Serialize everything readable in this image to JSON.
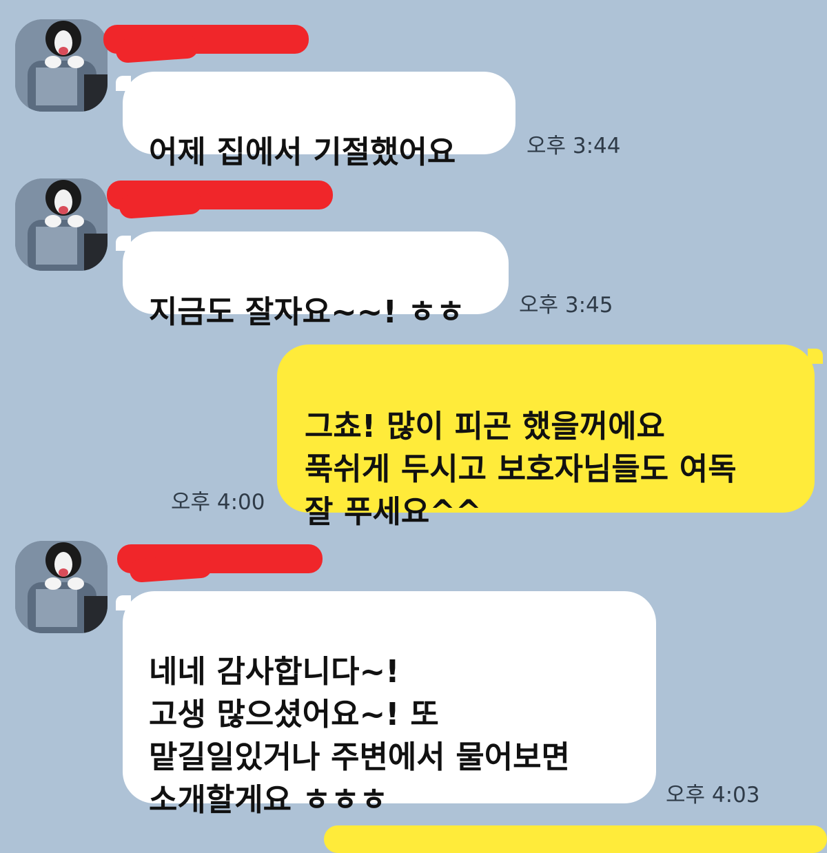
{
  "messages": [
    {
      "sender": "other",
      "text": "어제 집에서 기절했어요",
      "time": "오후 3:44"
    },
    {
      "sender": "other",
      "text": "지금도 잘자요~~! ㅎㅎ",
      "time": "오후 3:45"
    },
    {
      "sender": "me",
      "text": "그쵸! 많이 피곤 했을꺼에요\n푹쉬게 두시고 보호자님들도 여독\n잘 푸세요^^",
      "time": "오후 4:00"
    },
    {
      "sender": "other",
      "text": "네네 감사합니다~!\n고생 많으셨어요~! 또\n맡길일있거나 주변에서 물어보면\n소개할게요 ㅎㅎㅎ",
      "time": "오후 4:03"
    }
  ],
  "colors": {
    "background": "#AEC2D6",
    "incoming_bubble": "#FFFFFF",
    "outgoing_bubble": "#FFEB3A",
    "redaction": "#F0262A"
  },
  "icons": {
    "avatar": "dog-profile-photo-avatar"
  }
}
